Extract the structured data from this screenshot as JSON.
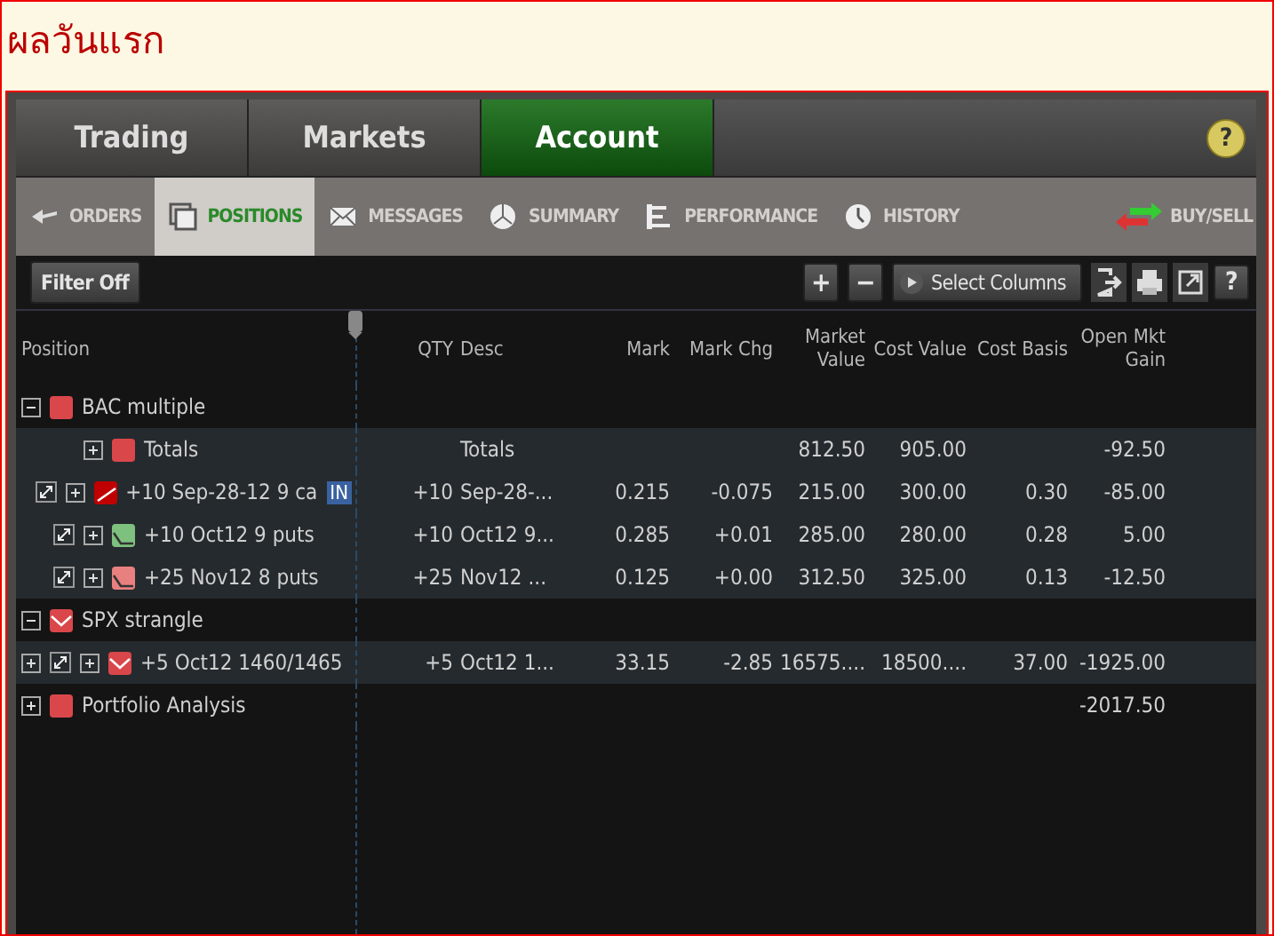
{
  "page_title": "ผลวันแรก",
  "main_tabs": [
    {
      "label": "Trading",
      "selected": false
    },
    {
      "label": "Markets",
      "selected": false
    },
    {
      "label": "Account",
      "selected": true
    }
  ],
  "sub_tabs": [
    {
      "label": "ORDERS",
      "selected": false
    },
    {
      "label": "POSITIONS",
      "selected": true
    },
    {
      "label": "MESSAGES",
      "selected": false
    },
    {
      "label": "SUMMARY",
      "selected": false
    },
    {
      "label": "PERFORMANCE",
      "selected": false
    },
    {
      "label": "HISTORY",
      "selected": false
    }
  ],
  "help": "?",
  "buy_sell": {
    "label": "BUY/SELL"
  },
  "toolbar": {
    "filter": "Filter Off",
    "expand": "+",
    "collapse": "−",
    "select_columns": "Select Columns",
    "help": "?"
  },
  "columns": [
    "QTY",
    "Desc",
    "Mark",
    "Mark Chg",
    "Market Value",
    "Cost Value",
    "Cost Basis",
    "Open Mkt Gain"
  ],
  "position_header": "Position",
  "groups": [
    {
      "name": "BAC multiple",
      "expanded": true,
      "color": "#d9474b",
      "kind": "plain",
      "children": [
        {
          "kind": "totals",
          "name": "Totals",
          "expanded": false,
          "color": "#d9474b",
          "cells": [
            null,
            "Totals",
            null,
            null,
            "812.50",
            "905.00",
            null,
            "-92.50"
          ]
        },
        {
          "kind": "call",
          "name": "+10 Sep-28-12 9 ca",
          "expanded": false,
          "color": "#c00000",
          "badge": "IN",
          "cells": [
            "+10",
            "Sep-28-...",
            "0.215",
            "-0.075",
            "215.00",
            "300.00",
            "0.30",
            "-85.00"
          ]
        },
        {
          "kind": "put",
          "name": "+10 Oct12 9 puts",
          "expanded": false,
          "color": "#7ec07e",
          "cells": [
            "+10",
            "Oct12 9...",
            "0.285",
            "+0.01",
            "285.00",
            "280.00",
            "0.28",
            "5.00"
          ]
        },
        {
          "kind": "put",
          "name": "+25 Nov12 8 puts",
          "expanded": false,
          "color": "#e88080",
          "cells": [
            "+25",
            "Nov12 ...",
            "0.125",
            "+0.00",
            "312.50",
            "325.00",
            "0.13",
            "-12.50"
          ]
        }
      ]
    },
    {
      "name": "SPX strangle",
      "expanded": true,
      "color": "#d9474b",
      "kind": "strangle",
      "children": [
        {
          "kind": "spread",
          "name": "+5 Oct12 1460/1465",
          "expanded": false,
          "color": "#d9474b",
          "cells": [
            "+5",
            "Oct12 1...",
            "33.15",
            "-2.85",
            "16575....",
            "18500....",
            "37.00",
            "-1925.00"
          ]
        }
      ]
    },
    {
      "name": "Portfolio Analysis",
      "expanded": false,
      "color": "#d9474b",
      "kind": "plain",
      "cells": [
        null,
        null,
        null,
        null,
        null,
        null,
        null,
        "-2017.50"
      ]
    }
  ]
}
